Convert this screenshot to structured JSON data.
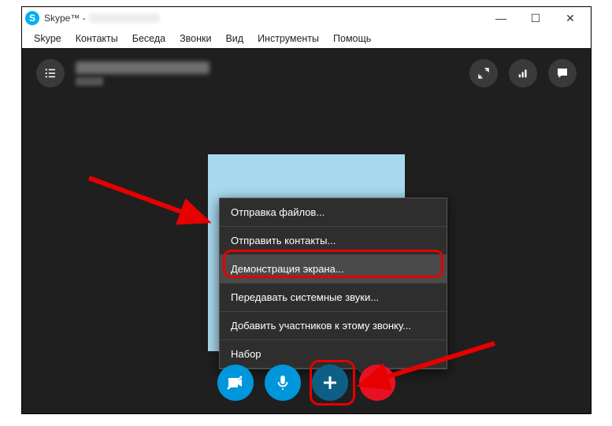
{
  "window": {
    "title_prefix": "Skype™ - "
  },
  "win_controls": {
    "min": "—",
    "max": "☐",
    "close": "✕"
  },
  "menubar": {
    "items": [
      "Skype",
      "Контакты",
      "Беседа",
      "Звонки",
      "Вид",
      "Инструменты",
      "Помощь"
    ]
  },
  "popup": {
    "items": [
      {
        "label": "Отправка файлов..."
      },
      {
        "label": "Отправить контакты..."
      },
      {
        "label": "Демонстрация экрана...",
        "highlighted": true
      },
      {
        "label": "Передавать системные звуки..."
      },
      {
        "label": "Добавить участников к этому звонку..."
      },
      {
        "label": "Набор"
      }
    ]
  }
}
